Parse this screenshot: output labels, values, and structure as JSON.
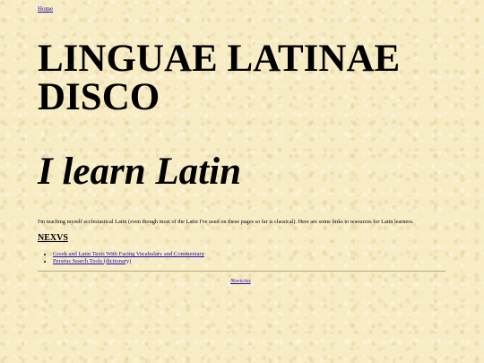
{
  "nav": {
    "home_label": "Home"
  },
  "page": {
    "title": "LINGUAE LATINAE DISCO",
    "subtitle": "I learn Latin",
    "intro": "I'm teaching myself ecclesiastical Latin (even though most of the Latin I've used on these pages so far is classical). Here are some links to resources for Latin learners."
  },
  "links_section": {
    "heading": "NEXVS",
    "items": [
      {
        "label": "Greek and Latin Texts With Facing Vocabulary and Commentary"
      },
      {
        "label": "Perseus Search Tools (dictionary)"
      }
    ]
  },
  "footer": {
    "link_label": "Novicius"
  }
}
